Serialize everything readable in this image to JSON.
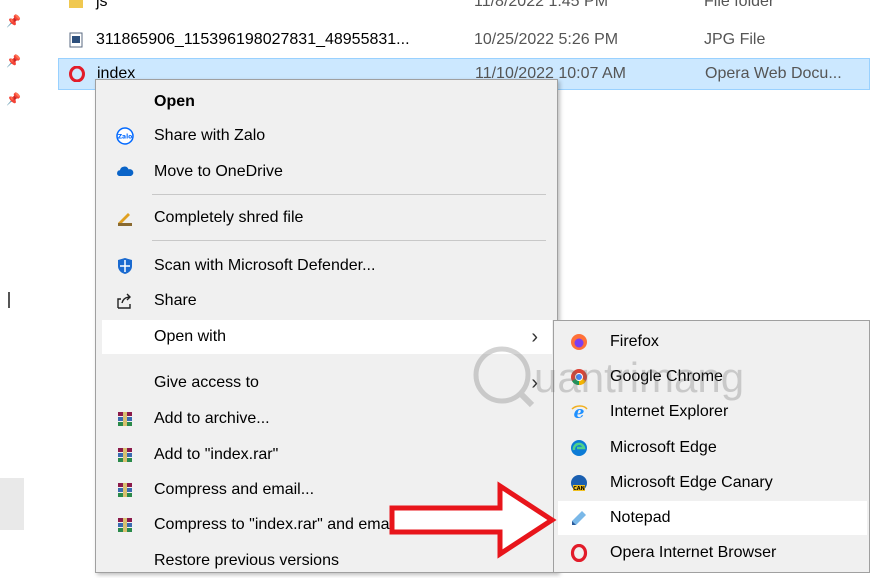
{
  "file_list": {
    "rows": [
      {
        "name": "js",
        "date": "11/8/2022 1:45 PM",
        "type": "File folder",
        "icon": "folder-icon"
      },
      {
        "name": "311865906_115396198027831_48955831...",
        "date": "10/25/2022 5:26 PM",
        "type": "JPG File",
        "icon": "image-file-icon"
      },
      {
        "name": "index",
        "date": "11/10/2022 10:07 AM",
        "type": "Opera Web Docu...",
        "icon": "opera-icon"
      }
    ]
  },
  "context_menu": {
    "open": "Open",
    "share_zalo": "Share with Zalo",
    "zalo_badge": "Zalo",
    "onedrive": "Move to OneDrive",
    "shred": "Completely shred file",
    "defender": "Scan with Microsoft Defender...",
    "share": "Share",
    "open_with": "Open with",
    "give_access": "Give access to",
    "add_archive": "Add to archive...",
    "add_rar": "Add to \"index.rar\"",
    "compress_email": "Compress and email...",
    "compress_rar_email": "Compress to \"index.rar\" and email",
    "restore": "Restore previous versions"
  },
  "open_with_menu": {
    "items": [
      "Firefox",
      "Google Chrome",
      "Internet Explorer",
      "Microsoft Edge",
      "Microsoft Edge Canary",
      "Notepad",
      "Opera Internet Browser"
    ],
    "canary_badge": "CAN"
  },
  "watermark": {
    "text": "uantrimang"
  },
  "colors": {
    "selection": "#cce8ff",
    "menu_bg": "#f0f0f0",
    "hover": "#ffffff",
    "arrow_red": "#e8151b",
    "opera_red": "#e21c2a"
  }
}
